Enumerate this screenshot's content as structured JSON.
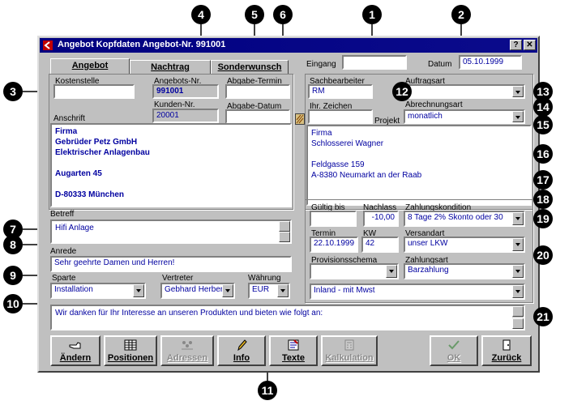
{
  "window": {
    "title": "Angebot Kopfdaten Angebot-Nr. 991001",
    "help_btn": "?",
    "close_btn": "✕"
  },
  "tabs": [
    {
      "label": "Angebot"
    },
    {
      "label": "Nachtrag"
    },
    {
      "label": "Sonderwunsch"
    }
  ],
  "header": {
    "eingang_label": "Eingang",
    "eingang_value": "",
    "datum_label": "Datum",
    "datum_value": "05.10.1999"
  },
  "left": {
    "kostenstelle_label": "Kostenstelle",
    "kostenstelle_value": "",
    "angebots_nr_label": "Angebots-Nr.",
    "angebots_nr_value": "991001",
    "abgabe_termin_label": "Abgabe-Termin",
    "abgabe_termin_value": "",
    "kunden_nr_label": "Kunden-Nr.",
    "kunden_nr_value": "20001",
    "abgabe_datum_label": "Abgabe-Datum",
    "abgabe_datum_value": "",
    "anschrift_label": "Anschrift",
    "anschrift_lines": [
      "Firma",
      "Gebrüder Petz GmbH",
      "Elektrischer Anlagenbau",
      "",
      "Augarten 45",
      "",
      "D-80333 München"
    ],
    "betreff_label": "Betreff",
    "betreff_value": "Hifi Anlage",
    "anrede_label": "Anrede",
    "anrede_value": "Sehr geehrte Damen und Herren!",
    "sparte_label": "Sparte",
    "sparte_value": "Installation",
    "vertreter_label": "Vertreter",
    "vertreter_value": "Gebhard Herbert",
    "waehrung_label": "Währung",
    "waehrung_value": "EUR"
  },
  "right": {
    "sachbearbeiter_label": "Sachbearbeiter",
    "sachbearbeiter_value": "RM",
    "auftragsart_label": "Auftragsart",
    "auftragsart_value": "",
    "ihr_zeichen_label": "Ihr. Zeichen",
    "ihr_zeichen_value": "",
    "projekt_label": "Projekt",
    "abrechnungsart_label": "Abrechnungsart",
    "abrechnungsart_value": "monatlich",
    "address_lines": [
      "Firma",
      "Schlosserei Wagner",
      "",
      "Feldgasse 159",
      "A-8380 Neumarkt an der Raab"
    ],
    "gueltig_bis_label": "Gültig bis",
    "gueltig_bis_value": "",
    "nachlass_label": "Nachlass",
    "nachlass_value": "-10,00",
    "zahlungskondition_label": "Zahlungskondition",
    "zahlungskondition_value": "8 Tage 2% Skonto oder 30",
    "termin_label": "Termin",
    "termin_value": "22.10.1999",
    "kw_label": "KW",
    "kw_value": "42",
    "versandart_label": "Versandart",
    "versandart_value": "unser LKW",
    "provisionsschema_label": "Provisionsschema",
    "provisionsschema_value": "",
    "zahlungsart_label": "Zahlungsart",
    "zahlungsart_value": "Barzahlung",
    "steuer_value": "Inland - mit Mwst"
  },
  "footer_text": "Wir danken für Ihr Interesse an unseren Produkten und bieten wie folgt an:",
  "buttons": [
    {
      "label": "Ändern",
      "icon": "pointing-hand-icon"
    },
    {
      "label": "Positionen",
      "icon": "table-icon"
    },
    {
      "label": "Adressen",
      "icon": "people-icon"
    },
    {
      "label": "Info",
      "icon": "pencil-icon"
    },
    {
      "label": "Texte",
      "icon": "text-document-icon"
    },
    {
      "label": "Kalkulation",
      "icon": "calculator-icon"
    },
    {
      "label": "OK",
      "icon": "checkmark-icon"
    },
    {
      "label": "Zurück",
      "icon": "door-icon"
    }
  ],
  "callouts": [
    "1",
    "2",
    "3",
    "4",
    "5",
    "6",
    "7",
    "8",
    "9",
    "10",
    "11",
    "12",
    "13",
    "14",
    "15",
    "16",
    "17",
    "18",
    "19",
    "20",
    "21"
  ]
}
